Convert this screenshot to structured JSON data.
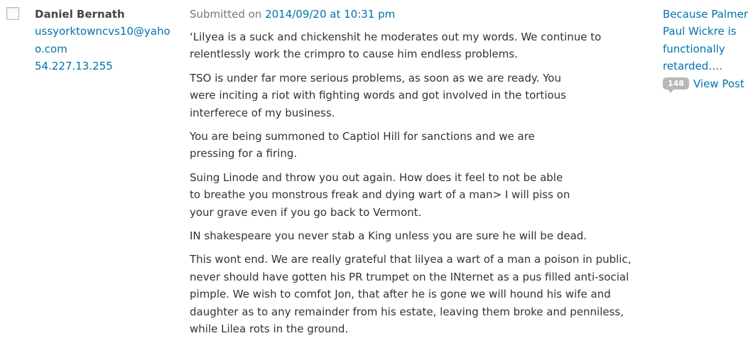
{
  "author": {
    "name": "Daniel Bernath",
    "email": "ussyorktowncvs10@yahoo.com",
    "ip": "54.227.13.255"
  },
  "submitted": {
    "prefix": "Submitted on ",
    "datetime": "2014/09/20 at 10:31 pm"
  },
  "comment": {
    "paragraphs": [
      "‘Lilyea is a suck and chickenshit he moderates out my words. We continue to relentlessly work the crimpro to cause him endless problems.",
      "TSO is under far more serious problems, as soon as we are ready. You were inciting a riot with fighting words and got involved in the tortious interferece of my business.",
      "You are being summoned to Captiol Hill for sanctions and we are pressing for a firing.",
      "Suing Linode and throw you out again. How does it feel to not be able to breathe you monstrous freak and dying wart of a man> I will piss on your grave even if you go back to Vermont.",
      "IN shakespeare you never stab a King unless you are sure he will be dead.",
      "This wont end. We are really grateful that lilyea a wart of a man a poison in public, never should have gotten his PR trumpet on the INternet as a pus filled anti-social pimple. We wish to comfot Jon, that after he is gone we will hound his wife and daughter as to any remainder from his estate, leaving them broke and penniless, while Lilea rots in the ground."
    ]
  },
  "response": {
    "post_title": "Because Palmer Paul Wickre is functionally retarded….",
    "comment_count": "148",
    "view_post": "View Post"
  }
}
